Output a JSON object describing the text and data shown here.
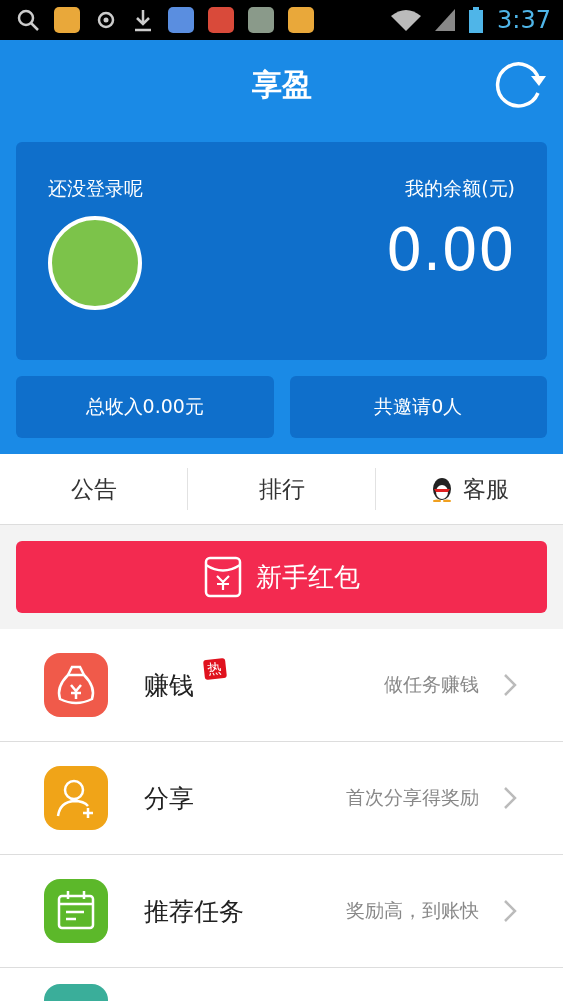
{
  "status_bar": {
    "time": "3:37"
  },
  "header": {
    "title": "享盈"
  },
  "account": {
    "login_prompt": "还没登录呢",
    "balance_label": "我的余额(元)",
    "balance": "0.00"
  },
  "stats": [
    "总收入0.00元",
    "共邀请0人"
  ],
  "nav": [
    {
      "label": "公告",
      "kind": "text"
    },
    {
      "label": "排行",
      "kind": "text"
    },
    {
      "label": "客服",
      "kind": "qq"
    }
  ],
  "red_packet": {
    "label": "新手红包"
  },
  "menu": [
    {
      "kind": "money",
      "color": "#f05a4a",
      "title": "赚钱",
      "badge": "热",
      "hint": "做任务赚钱"
    },
    {
      "kind": "user",
      "color": "#f0a418",
      "title": "分享",
      "hint": "首次分享得奖励"
    },
    {
      "kind": "calendar",
      "color": "#5cb82a",
      "title": "推荐任务",
      "hint": "奖励高，到账快"
    },
    {
      "kind": "partial",
      "color": "#3aae9a"
    }
  ]
}
